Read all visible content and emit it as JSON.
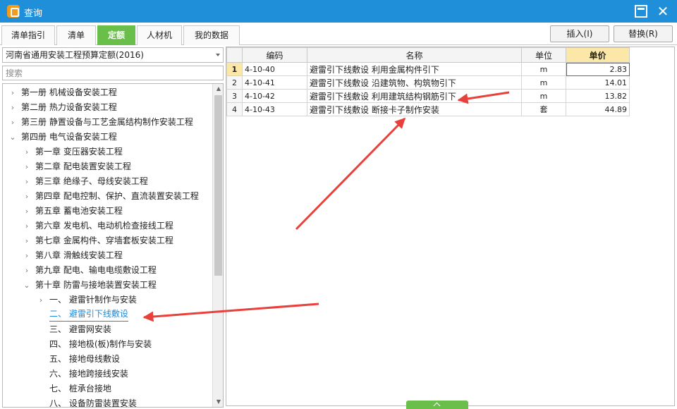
{
  "window": {
    "title": "查询",
    "icon": "app-logo-icon",
    "maximize_icon": "maximize-icon",
    "close_icon": "close-icon",
    "close_glyph": "✕"
  },
  "tabs": [
    {
      "label": "清单指引",
      "active": false
    },
    {
      "label": "清单",
      "active": false
    },
    {
      "label": "定额",
      "active": true
    },
    {
      "label": "人材机",
      "active": false
    },
    {
      "label": "我的数据",
      "active": false
    }
  ],
  "toolbar": {
    "insert_label": "插入(I)",
    "replace_label": "替换(R)"
  },
  "left": {
    "library": "河南省通用安装工程预算定额(2016)",
    "search_placeholder": "搜索",
    "tree": [
      {
        "label": "第一册 机械设备安装工程",
        "caret": "›",
        "level": 0
      },
      {
        "label": "第二册 热力设备安装工程",
        "caret": "›",
        "level": 0
      },
      {
        "label": "第三册 静置设备与工艺金属结构制作安装工程",
        "caret": "›",
        "level": 0
      },
      {
        "label": "第四册 电气设备安装工程",
        "caret": "⌄",
        "level": 0
      },
      {
        "label": "第一章 变压器安装工程",
        "caret": "›",
        "level": 1
      },
      {
        "label": "第二章 配电装置安装工程",
        "caret": "›",
        "level": 1
      },
      {
        "label": "第三章 绝缘子、母线安装工程",
        "caret": "›",
        "level": 1
      },
      {
        "label": "第四章 配电控制、保护、直流装置安装工程",
        "caret": "›",
        "level": 1
      },
      {
        "label": "第五章 蓄电池安装工程",
        "caret": "›",
        "level": 1
      },
      {
        "label": "第六章 发电机、电动机检查接线工程",
        "caret": "›",
        "level": 1
      },
      {
        "label": "第七章 金属构件、穿墙套板安装工程",
        "caret": "›",
        "level": 1
      },
      {
        "label": "第八章 滑触线安装工程",
        "caret": "›",
        "level": 1
      },
      {
        "label": "第九章 配电、输电电缆敷设工程",
        "caret": "›",
        "level": 1
      },
      {
        "label": "第十章 防雷与接地装置安装工程",
        "caret": "⌄",
        "level": 1
      },
      {
        "label": "一、  避雷针制作与安装",
        "caret": "›",
        "level": 2
      },
      {
        "label": "二、  避雷引下线敷设",
        "caret": "",
        "level": 2,
        "selected": true
      },
      {
        "label": "三、  避雷网安装",
        "caret": "",
        "level": 2
      },
      {
        "label": "四、  接地极(板)制作与安装",
        "caret": "",
        "level": 2
      },
      {
        "label": "五、  接地母线敷设",
        "caret": "",
        "level": 2
      },
      {
        "label": "六、  接地跨接线安装",
        "caret": "",
        "level": 2
      },
      {
        "label": "七、  桩承台接地",
        "caret": "",
        "level": 2
      },
      {
        "label": "八、  设备防雷装置安装",
        "caret": "",
        "level": 2
      }
    ]
  },
  "grid": {
    "headers": {
      "code": "编码",
      "name": "名称",
      "unit": "单位",
      "price": "单价"
    },
    "rows": [
      {
        "num": "1",
        "code": "4-10-40",
        "name": "避雷引下线敷设 利用金属构件引下",
        "unit": "m",
        "price": "2.83"
      },
      {
        "num": "2",
        "code": "4-10-41",
        "name": "避雷引下线敷设 沿建筑物、构筑物引下",
        "unit": "m",
        "price": "14.01"
      },
      {
        "num": "3",
        "code": "4-10-42",
        "name": "避雷引下线敷设 利用建筑结构钢筋引下",
        "unit": "m",
        "price": "13.82"
      },
      {
        "num": "4",
        "code": "4-10-43",
        "name": "避雷引下线敷设 断接卡子制作安装",
        "unit": "套",
        "price": "44.89"
      }
    ]
  },
  "colors": {
    "titlebar": "#1e8fd8",
    "active_tab": "#6abf4b",
    "price_header": "#fbe7a8",
    "selected_text": "#1a8ce0",
    "arrow": "#e8413b"
  },
  "annotations": {
    "icon": "red-arrow-icon"
  }
}
